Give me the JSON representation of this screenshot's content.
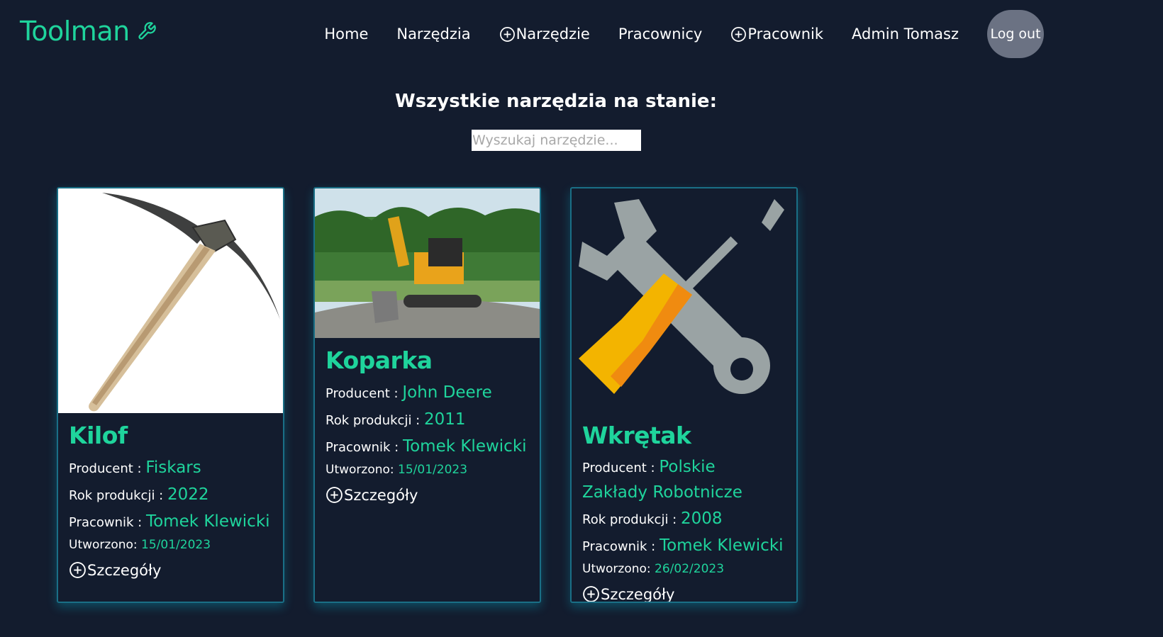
{
  "brand": {
    "name": "Toolman",
    "icon": "wrench-icon",
    "color": "#1fd49c"
  },
  "nav": {
    "items": [
      {
        "label": "Home",
        "icon": null
      },
      {
        "label": "Narzędzia",
        "icon": null
      },
      {
        "label": "Narzędzie",
        "icon": "plus-circle-icon"
      },
      {
        "label": "Pracownicy",
        "icon": null
      },
      {
        "label": "Pracownik",
        "icon": "plus-circle-icon"
      },
      {
        "label": "Admin Tomasz",
        "icon": null
      }
    ],
    "logout_label": "Log out"
  },
  "main": {
    "title": "Wszystkie narzędzia na stanie:",
    "search_placeholder": "Wyszukaj narzędzie..."
  },
  "labels": {
    "producer": "Producent : ",
    "year": "Rok produkcji : ",
    "worker": "Pracownik : ",
    "created": "Utworzono: ",
    "details": "Szczegóły"
  },
  "tools": [
    {
      "name": "Kilof",
      "producer": "Fiskars",
      "year": "2022",
      "worker": "Tomek Klewicki",
      "created": "15/01/2023",
      "image": "pickaxe-image"
    },
    {
      "name": "Koparka",
      "producer": "John Deere",
      "year": "2011",
      "worker": "Tomek Klewicki",
      "created": "15/01/2023",
      "image": "excavator-image"
    },
    {
      "name": "Wkrętak",
      "producer": "Polskie Zakłady Robotnicze",
      "year": "2008",
      "worker": "Tomek Klewicki",
      "created": "26/02/2023",
      "image": "wrench-screwdriver-image"
    }
  ],
  "colors": {
    "background": "#131c2e",
    "accent": "#1fd49c",
    "card_border": "#1a6f86",
    "logout_bg": "#6b7283"
  }
}
